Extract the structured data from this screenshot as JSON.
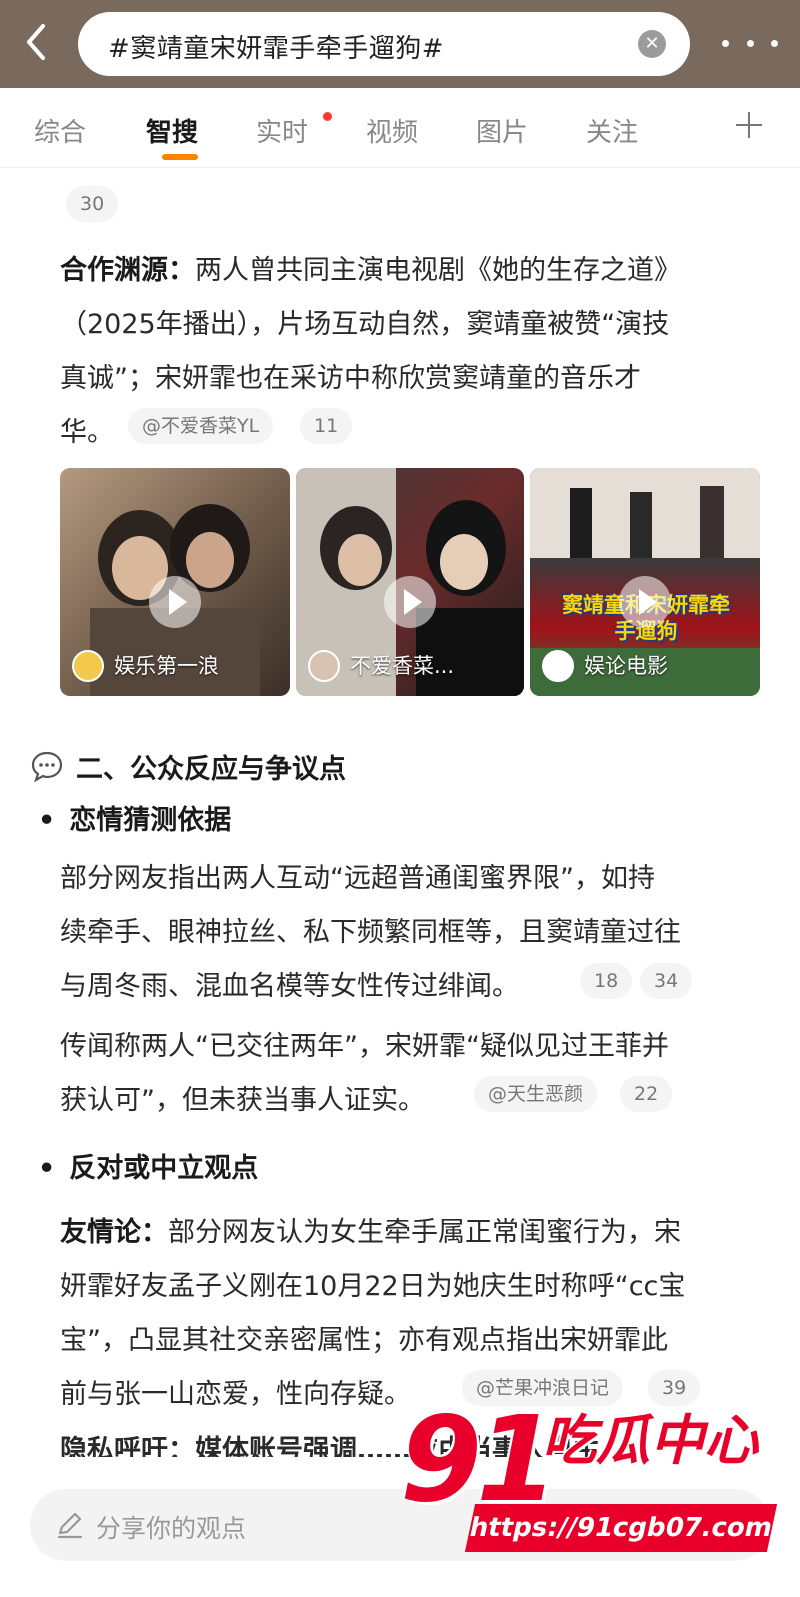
{
  "header": {
    "search_query": "#窦靖童宋妍霏手牵手遛狗#",
    "back_icon": "chevron-left-icon",
    "clear_icon": "clear-icon",
    "more_icon": "more-dots-icon"
  },
  "tabs": {
    "items": [
      "综合",
      "智搜",
      "实时",
      "视频",
      "图片",
      "关注"
    ],
    "active": "智搜",
    "accent_color": "#ff8200",
    "badge_color": "#ff3b30"
  },
  "content": {
    "top_count": "30",
    "origin": {
      "label": "合作渊源：",
      "line1": "两人曾共同主演电视剧《她的生存之道》",
      "line2": "（2025年播出），片场互动自然，窦靖童被赞“演技",
      "line3": "真诚”；宋妍霏也在采访中称欣赏窦靖童的音乐才",
      "line4": "华。",
      "source": "@不爱香菜YL",
      "count": "11"
    },
    "videos": [
      {
        "account": "娱乐第一浪"
      },
      {
        "account": "不爱香菜..."
      },
      {
        "account": "娱论电影",
        "caption": "窦靖童和宋妍霏牵手遛狗"
      }
    ],
    "section2_title": "二、公众反应与争议点",
    "sub1": {
      "title": "恋情猜测依据",
      "p1_l1": "部分网友指出两人互动“远超普通闺蜜界限”，如持",
      "p1_l2": "续牵手、眼神拉丝、私下频繁同框等，且窦靖童过往",
      "p1_l3": "与周冬雨、混血名模等女性传过绯闻。",
      "p1_c1": "18",
      "p1_c2": "34",
      "p2_l1": "传闻称两人“已交往两年”，宋妍霏“疑似见过王菲并",
      "p2_l2": "获认可”，但未获当事人证实。",
      "p2_source": "@天生恶颜",
      "p2_count": "22"
    },
    "sub2": {
      "title": "反对或中立观点",
      "label": "友情论：",
      "l1": "部分网友认为女生牵手属正常闺蜜行为，宋",
      "l2": "妍霏好友孟子义刚在10月22日为她庆生时称呼“cc宝",
      "l3": "宝”，凸显其社交亲密属性；亦有观点指出宋妍霏此",
      "l4": "前与张一山恋爱，性向存疑。",
      "source": "@芒果冲浪日记",
      "count": "39",
      "cut_line": "隐私呼吁：媒体账号强调……应由当事人自主"
    }
  },
  "bottom": {
    "share_placeholder": "分享你的观点"
  },
  "watermark": {
    "number": "91",
    "brand": "吃瓜中心",
    "url": "https://91cgb07.com",
    "color": "#e8002a"
  }
}
